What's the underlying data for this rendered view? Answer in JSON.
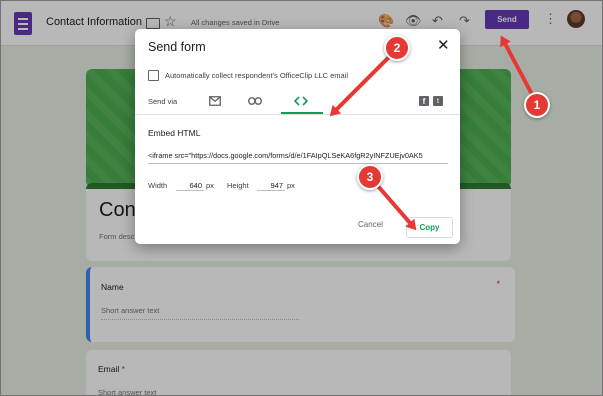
{
  "app": {
    "title": "Contact Information",
    "saved_status": "All changes saved in Drive",
    "send_label": "Send",
    "star_glyph": "☆",
    "more_glyph": "⋮",
    "toolbar_icons": [
      "palette-icon",
      "eye-icon",
      "undo-icon",
      "redo-icon"
    ],
    "toolbar_glyphs": [
      "🎨",
      "👁",
      "↶",
      "↷"
    ]
  },
  "form": {
    "title": "Contact Information",
    "description": "Form description",
    "questions": [
      {
        "label": "Name",
        "hint": "Short answer text",
        "required": "*"
      },
      {
        "label": "Email",
        "hint": "Short answer text",
        "required": "*"
      }
    ]
  },
  "dialog": {
    "title": "Send form",
    "close_glyph": "✕",
    "collect_email_label": "Automatically collect respondent's OfficeClip LLC email",
    "send_via_label": "Send via",
    "tabs": [
      {
        "name": "tab-email",
        "glyph": "✉"
      },
      {
        "name": "tab-link",
        "glyph": "🔗"
      },
      {
        "name": "tab-embed",
        "glyph": "<>"
      }
    ],
    "embed_heading": "Embed HTML",
    "embed_code": "<iframe src=\"https://docs.google.com/forms/d/e/1FAIpQLSeKA6fgR2yINFZUEjv0AK5",
    "width_label": "Width",
    "width_value": "640",
    "height_label": "Height",
    "height_value": "947",
    "unit": "px",
    "cancel_label": "Cancel",
    "copy_label": "Copy"
  },
  "annotations": {
    "badges": [
      "1",
      "2",
      "3"
    ],
    "color": "#e53935"
  },
  "colors": {
    "accent": "#673ab7",
    "embed_active": "#0f9d58",
    "banner": "#4caf50"
  }
}
